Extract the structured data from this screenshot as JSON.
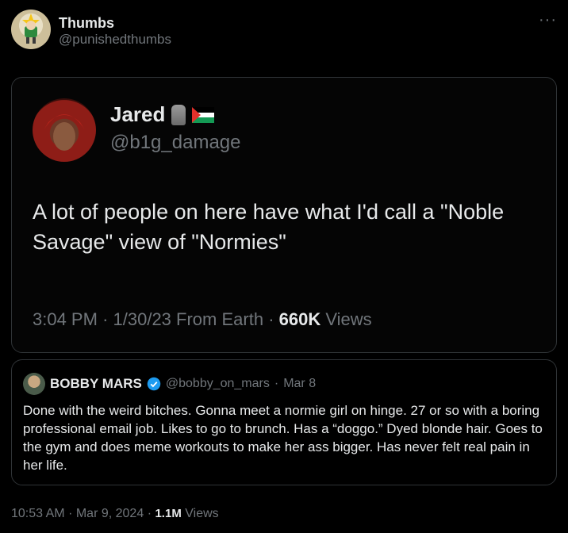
{
  "post": {
    "author_name": "Thumbs",
    "author_handle": "@punishedthumbs",
    "more_glyph": "···"
  },
  "quoted_tweet": {
    "author_name": "Jared",
    "author_handle": "@b1g_damage",
    "text": "A lot of people on here have what I'd call a \"Noble Savage\" view of \"Normies\"",
    "time": "3:04 PM",
    "date": "1/30/23",
    "source": "From Earth",
    "views_count": "660K",
    "views_label": "Views"
  },
  "quoted_post": {
    "author_name": "BOBBY MARS",
    "author_handle": "@bobby_on_mars",
    "date": "Mar 8",
    "text": "Done with the weird bitches. Gonna meet a normie girl on hinge. 27 or so with a boring professional email job. Likes to go to brunch. Has a “doggo.” Dyed blonde hair. Goes to the gym and does meme workouts to make her ass bigger. Has never felt real pain in her life."
  },
  "footer": {
    "time": "10:53 AM",
    "date": "Mar 9, 2024",
    "views_count": "1.1M",
    "views_label": "Views"
  },
  "icons": {
    "verified": "verified-badge-icon",
    "moai": "moai-emoji-icon",
    "flag": "palestine-flag-icon"
  },
  "colors": {
    "background": "#000000",
    "text": "#e7e9ea",
    "muted": "#71767b",
    "border": "#2f3336",
    "verified": "#1d9bf0"
  }
}
